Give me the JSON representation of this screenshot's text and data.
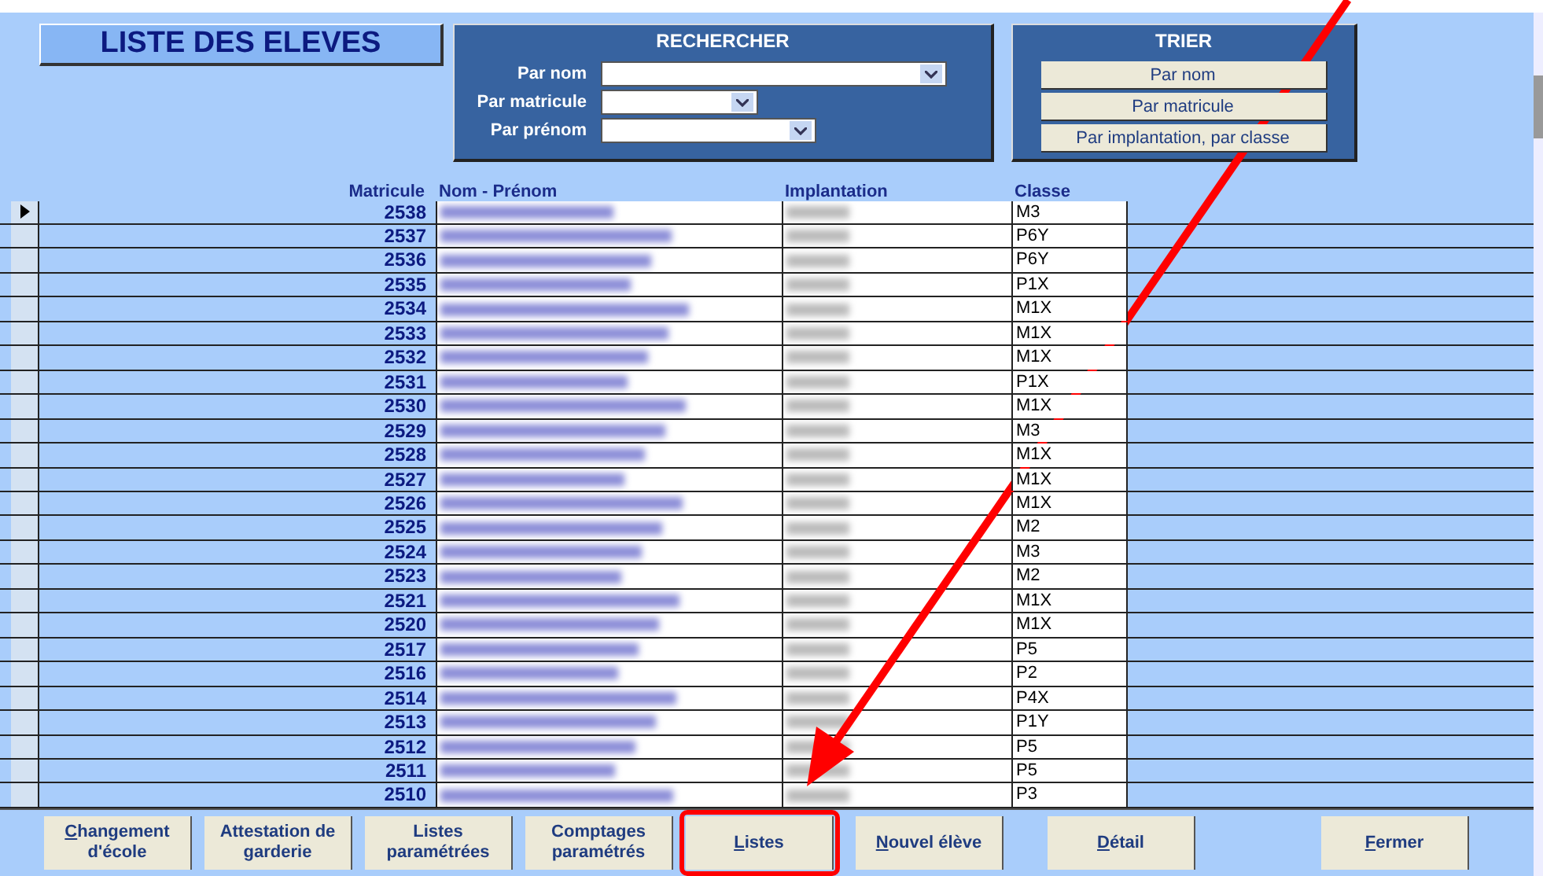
{
  "title": "LISTE DES ELEVES",
  "search": {
    "title": "RECHERCHER",
    "fields": [
      {
        "label": "Par nom"
      },
      {
        "label": "Par matricule"
      },
      {
        "label": "Par prénom"
      }
    ]
  },
  "sort": {
    "title": "TRIER",
    "buttons": [
      "Par nom",
      "Par matricule",
      "Par implantation, par classe"
    ]
  },
  "table": {
    "columns": [
      "Matricule",
      "Nom - Prénom",
      "Implantation",
      "Classe"
    ],
    "rows": [
      {
        "matricule": "2538",
        "classe": "M3",
        "current": true
      },
      {
        "matricule": "2537",
        "classe": "P6Y",
        "current": false
      },
      {
        "matricule": "2536",
        "classe": "P6Y",
        "current": false
      },
      {
        "matricule": "2535",
        "classe": "P1X",
        "current": false
      },
      {
        "matricule": "2534",
        "classe": "M1X",
        "current": false
      },
      {
        "matricule": "2533",
        "classe": "M1X",
        "current": false
      },
      {
        "matricule": "2532",
        "classe": "M1X",
        "current": false
      },
      {
        "matricule": "2531",
        "classe": "P1X",
        "current": false
      },
      {
        "matricule": "2530",
        "classe": "M1X",
        "current": false
      },
      {
        "matricule": "2529",
        "classe": "M3",
        "current": false
      },
      {
        "matricule": "2528",
        "classe": "M1X",
        "current": false
      },
      {
        "matricule": "2527",
        "classe": "M1X",
        "current": false
      },
      {
        "matricule": "2526",
        "classe": "M1X",
        "current": false
      },
      {
        "matricule": "2525",
        "classe": "M2",
        "current": false
      },
      {
        "matricule": "2524",
        "classe": "M3",
        "current": false
      },
      {
        "matricule": "2523",
        "classe": "M2",
        "current": false
      },
      {
        "matricule": "2521",
        "classe": "M1X",
        "current": false
      },
      {
        "matricule": "2520",
        "classe": "M1X",
        "current": false
      },
      {
        "matricule": "2517",
        "classe": "P5",
        "current": false
      },
      {
        "matricule": "2516",
        "classe": "P2",
        "current": false
      },
      {
        "matricule": "2514",
        "classe": "P4X",
        "current": false
      },
      {
        "matricule": "2513",
        "classe": "P1Y",
        "current": false
      },
      {
        "matricule": "2512",
        "classe": "P5",
        "current": false
      },
      {
        "matricule": "2511",
        "classe": "P5",
        "current": false
      },
      {
        "matricule": "2510",
        "classe": "P3",
        "current": false
      }
    ]
  },
  "buttons": [
    {
      "lines": [
        "Changement",
        "d'école"
      ],
      "underline_first": true,
      "highlighted": false
    },
    {
      "lines": [
        "Attestation de",
        "garderie"
      ],
      "underline_first": false,
      "highlighted": false
    },
    {
      "lines": [
        "Listes",
        "paramétrées"
      ],
      "underline_first": false,
      "highlighted": false
    },
    {
      "lines": [
        "Comptages",
        "paramétrés"
      ],
      "underline_first": false,
      "highlighted": false
    },
    {
      "lines": [
        "Listes"
      ],
      "underline_first": true,
      "highlighted": true
    },
    {
      "lines": [
        "Nouvel élève"
      ],
      "underline_first": true,
      "highlighted": false
    },
    {
      "lines": [
        "Détail"
      ],
      "underline_first": true,
      "highlighted": false
    },
    {
      "lines": [
        "Fermer"
      ],
      "underline_first": true,
      "highlighted": false
    }
  ]
}
